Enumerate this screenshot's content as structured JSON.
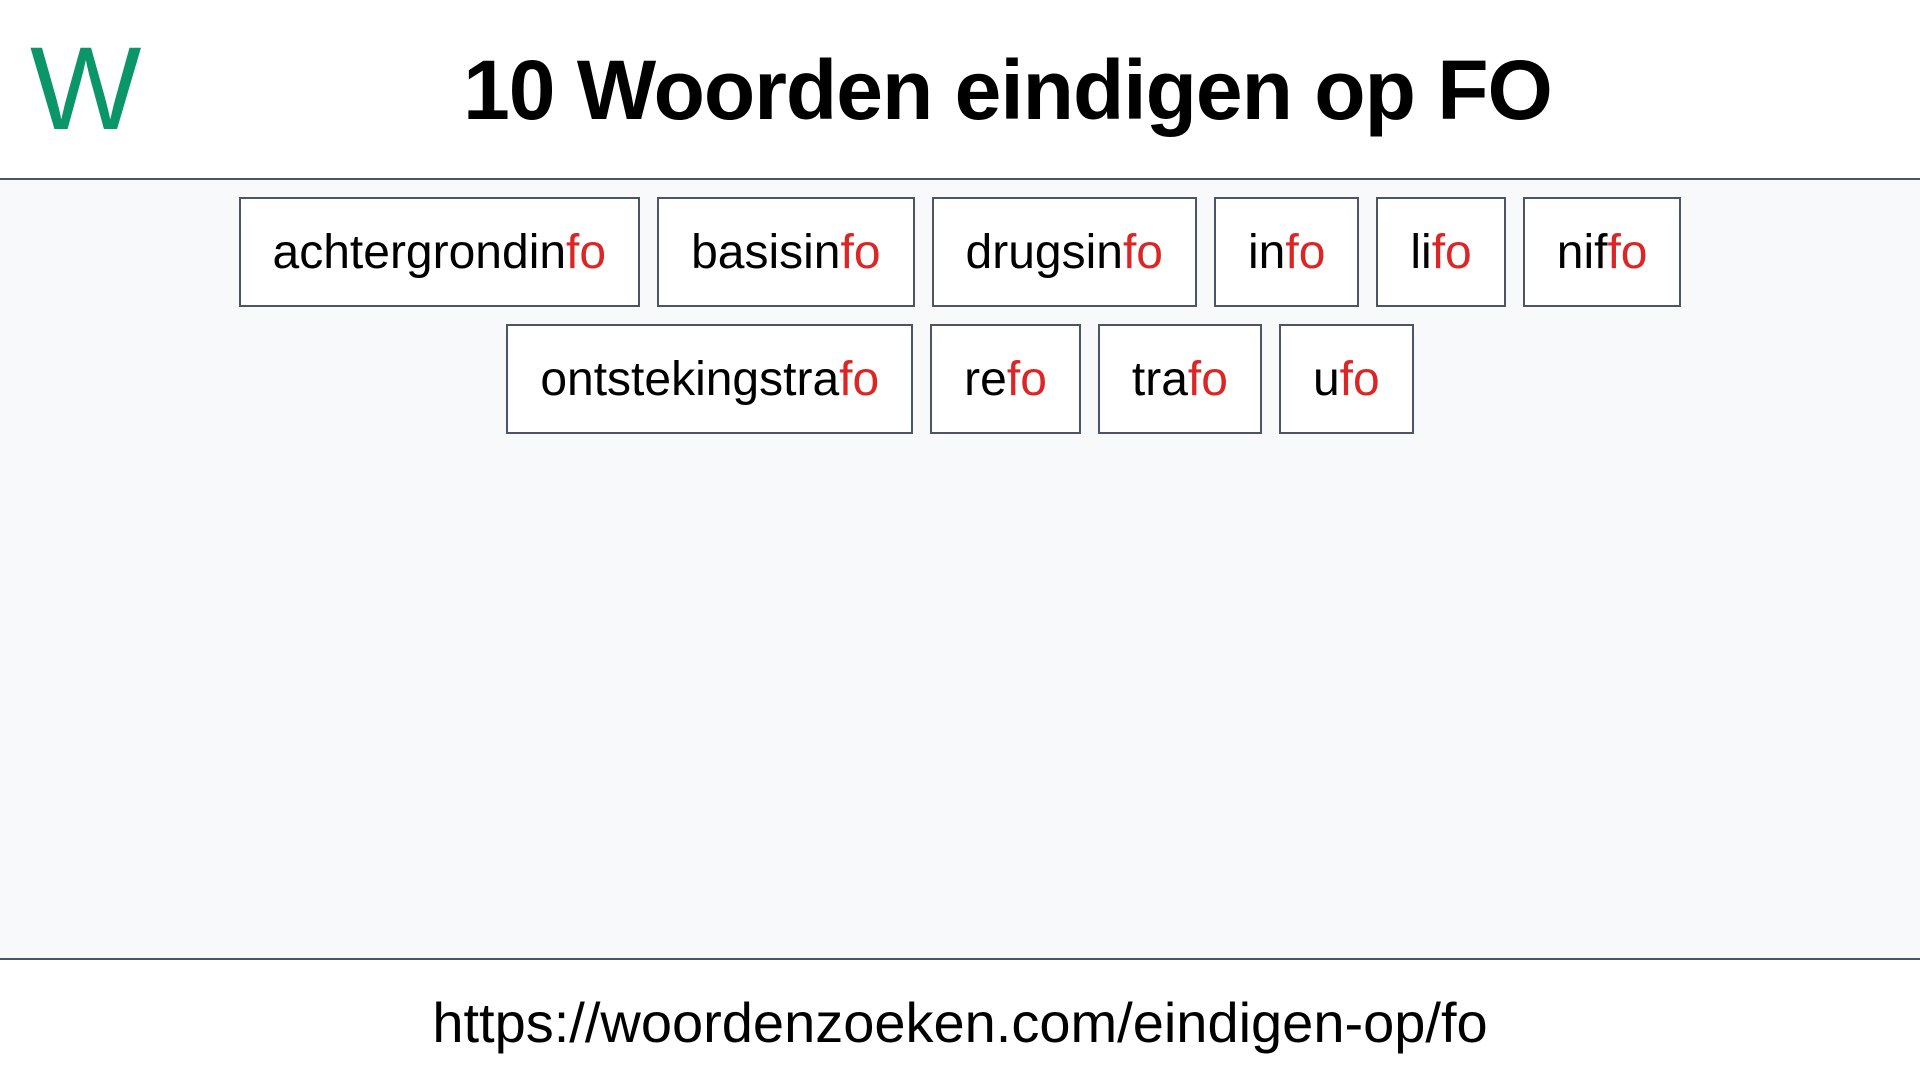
{
  "header": {
    "logo_letter": "W",
    "title": "10 Woorden eindigen op FO"
  },
  "colors": {
    "logo": "#0a9669",
    "suffix_highlight": "#dc2626",
    "border": "#4b5563",
    "background": "#f8f9fb"
  },
  "words": [
    {
      "prefix": "achtergrondin",
      "suffix": "fo"
    },
    {
      "prefix": "basisin",
      "suffix": "fo"
    },
    {
      "prefix": "drugsin",
      "suffix": "fo"
    },
    {
      "prefix": "in",
      "suffix": "fo"
    },
    {
      "prefix": "li",
      "suffix": "fo"
    },
    {
      "prefix": "nif",
      "suffix": "fo"
    },
    {
      "prefix": "ontstekingstra",
      "suffix": "fo"
    },
    {
      "prefix": "re",
      "suffix": "fo"
    },
    {
      "prefix": "tra",
      "suffix": "fo"
    },
    {
      "prefix": "u",
      "suffix": "fo"
    }
  ],
  "footer": {
    "url": "https://woordenzoeken.com/eindigen-op/fo"
  }
}
